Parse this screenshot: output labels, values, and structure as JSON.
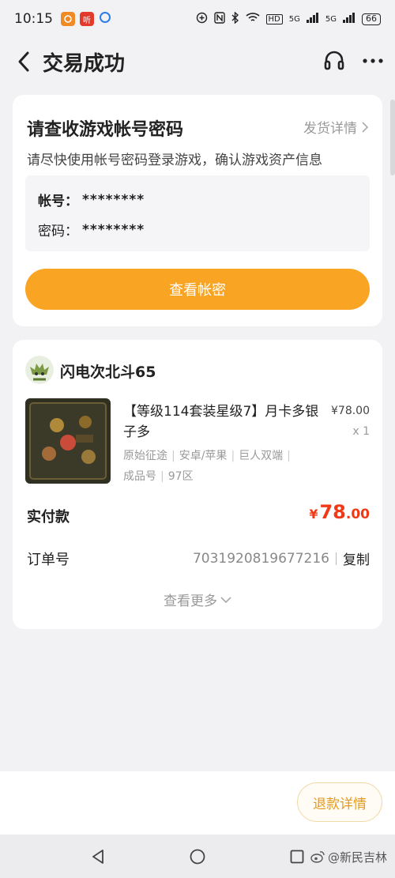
{
  "status_bar": {
    "time": "10:15",
    "app_badge_text": "听",
    "network_labels": [
      "5G",
      "5G"
    ],
    "hd_label": "HD",
    "battery": "66"
  },
  "header": {
    "title": "交易成功",
    "back_icon": "chevron-left-icon",
    "support_icon": "headset-icon",
    "more_icon": "more-dots-icon"
  },
  "account_card": {
    "title": "请查收游戏帐号密码",
    "detail_link": "发货详情",
    "subtitle": "请尽快使用帐号密码登录游戏，确认游戏资产信息",
    "account_label": "帐号：",
    "account_value": "********",
    "password_label": "密码：",
    "password_value": "********",
    "view_button": "查看帐密"
  },
  "order_card": {
    "seller_name": "闪电次北斗65",
    "product_title": "【等级114套装星级7】月卡多银子多",
    "price": "¥78.00",
    "quantity": "x 1",
    "tags": [
      "原始征途",
      "安卓/苹果",
      "巨人双端",
      "成品号",
      "97区"
    ],
    "paid_label": "实付款",
    "paid_currency": "¥",
    "paid_int": "78",
    "paid_dec": ".00",
    "order_label": "订单号",
    "order_number": "7031920819677216",
    "copy_label": "复制",
    "more_label": "查看更多"
  },
  "bottom": {
    "refund_button": "退款详情"
  },
  "watermark": "@新民吉林",
  "colors": {
    "accent_orange": "#f9a423",
    "price_red": "#f03a17",
    "refund_text": "#e59a1d",
    "page_bg": "#f2f2f4"
  }
}
